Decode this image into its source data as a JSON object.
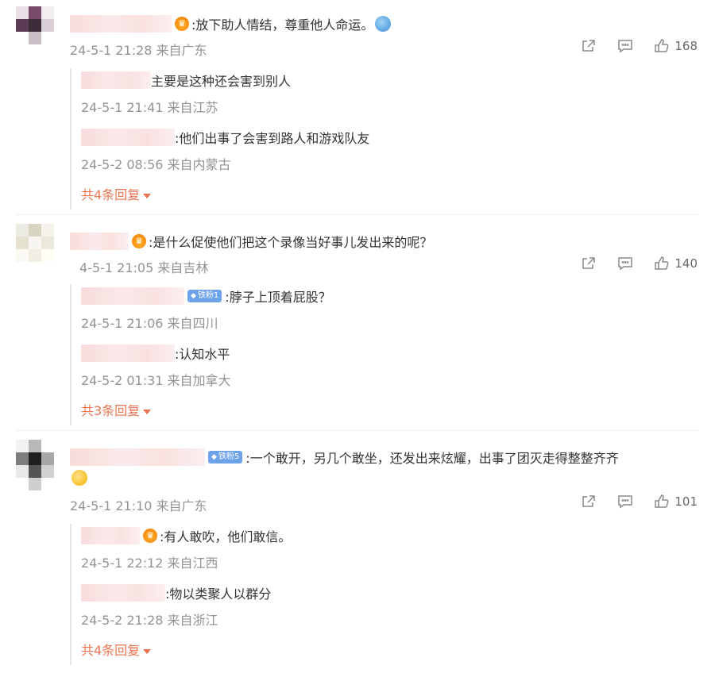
{
  "colors": {
    "accent": "#eb7350",
    "meta_text": "#939393",
    "main_text": "#333333",
    "fan_badge": "#6ea3ea"
  },
  "actions_icons": [
    "share-icon",
    "comment-icon",
    "like-icon"
  ],
  "comments": [
    {
      "text": ":放下助人情结，尊重他人命运。",
      "meta": "24-5-1 21:28 来自广东",
      "likes": "168",
      "replies": [
        {
          "text": "主要是这种还会害到别人",
          "meta": "24-5-1 21:41 来自江苏"
        },
        {
          "text": ":他们出事了会害到路人和游戏队友",
          "meta": "24-5-2 08:56 来自内蒙古"
        }
      ],
      "more": "共4条回复"
    },
    {
      "text": ":是什么促使他们把这个录像当好事儿发出来的呢？",
      "meta": "4-5-1 21:05 来自吉林",
      "likes": "140",
      "replies": [
        {
          "badge": "铁粉1",
          "text": ":脖子上顶着屁股？",
          "meta": "24-5-1 21:06 来自四川"
        },
        {
          "text": ":认知水平",
          "meta": "24-5-2 01:31 来自加拿大"
        }
      ],
      "more": "共3条回复"
    },
    {
      "badge": "铁粉5",
      "text": ":一个敢开，另几个敢坐，还发出来炫耀，出事了团灭走得整整齐齐",
      "meta": "24-5-1 21:10 来自广东",
      "likes": "101",
      "replies": [
        {
          "text": ":有人敢吹，他们敢信。",
          "meta": "24-5-1 22:12 来自江西"
        },
        {
          "text": ":物以类聚人以群分",
          "meta": "24-5-2 21:28 来自浙江"
        }
      ],
      "more": "共4条回复"
    }
  ]
}
